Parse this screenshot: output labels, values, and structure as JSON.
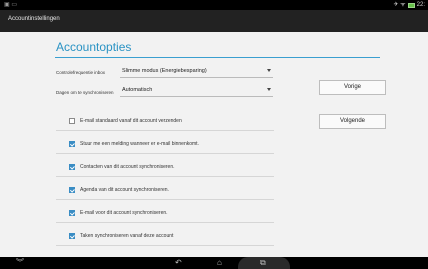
{
  "statusbar": {
    "left_icons": "▣ ▭",
    "right_icons": "✈ ᯤ",
    "time": "22:"
  },
  "titlebar": {
    "title": "Accountinstellingen"
  },
  "main": {
    "heading": "Accountopties",
    "fields": [
      {
        "label": "Controlefrequentie inbox",
        "value": "Slimme modus (Energiebesparing)"
      },
      {
        "label": "Dagen om te synchroniseren",
        "value": "Automatisch"
      }
    ],
    "checkboxes": [
      {
        "label": "E-mail standaard vanaf dit account verzenden",
        "checked": false
      },
      {
        "label": "Stuur me een melding wanneer er e-mail binnenkomt.",
        "checked": true
      },
      {
        "label": "Contacten van dit account synchroniseren.",
        "checked": true
      },
      {
        "label": "Agenda van dit account synchroniseren.",
        "checked": true
      },
      {
        "label": "E-mail voor dit account synchroniseren.",
        "checked": true
      },
      {
        "label": "Taken synchroniseren vanaf deze account",
        "checked": true
      }
    ]
  },
  "buttons": {
    "previous": "Vorige",
    "next": "Volgende"
  },
  "navbar": {
    "keyboard_hide_icon": "keyboard-hide-icon",
    "back_icon": "back-icon",
    "home_icon": "home-icon",
    "recents_icon": "recents-icon"
  }
}
